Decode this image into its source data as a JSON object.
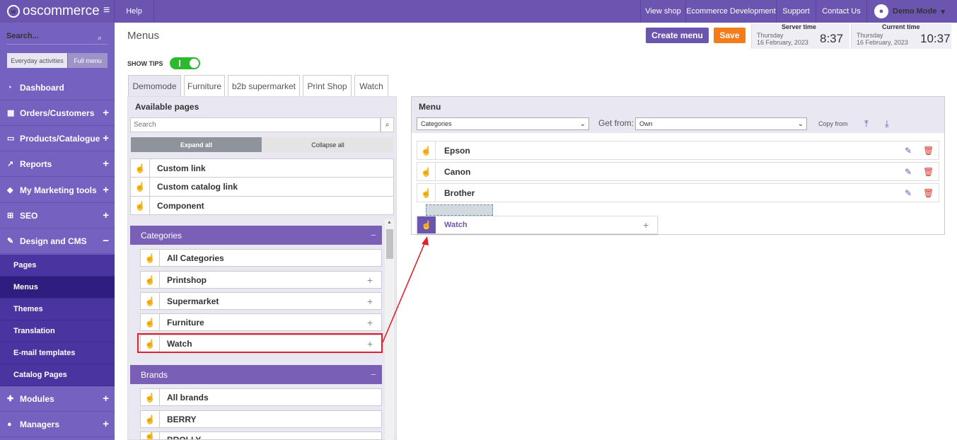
{
  "topbar": {
    "logo": "oscommerce",
    "help": "Help",
    "nav": [
      "View shop",
      "Ecommerce Development",
      "Support",
      "Contact Us"
    ],
    "user": "Demo Mode"
  },
  "sidebar": {
    "search": "Search...",
    "toggle": [
      "Everyday activities",
      "Full menu"
    ],
    "items": [
      {
        "label": "Dashboard",
        "icon": "dashboard-icon"
      },
      {
        "label": "Orders/Customers",
        "icon": "orders-icon"
      },
      {
        "label": "Products/Catalogue",
        "icon": "folder-icon"
      },
      {
        "label": "Reports",
        "icon": "chart-icon"
      },
      {
        "label": "My Marketing tools",
        "icon": "tag-icon"
      },
      {
        "label": "SEO",
        "icon": "sitemap-icon"
      },
      {
        "label": "Design and CMS",
        "icon": "brush-icon"
      }
    ],
    "subitems": [
      "Pages",
      "Menus",
      "Themes",
      "Translation",
      "E-mail templates",
      "Catalog Pages"
    ],
    "bottom": [
      {
        "label": "Modules",
        "icon": "puzzle-icon"
      },
      {
        "label": "Managers",
        "icon": "user-icon"
      }
    ]
  },
  "header": {
    "title": "Menus",
    "create": "Create menu",
    "save": "Save",
    "server": {
      "label": "Server time",
      "day": "Thursday",
      "date": "16 February, 2023",
      "time": "8:37"
    },
    "current": {
      "label": "Current time",
      "day": "Thursday",
      "date": "16 February, 2023",
      "time": "10:37"
    }
  },
  "tips": {
    "label": "SHOW TIPS"
  },
  "tabs": [
    "Demomode",
    "Furniture",
    "b2b supermarket",
    "Print Shop",
    "Watch"
  ],
  "left": {
    "title": "Available pages",
    "search_placeholder": "Search",
    "expand": "Expand all",
    "collapse": "Collapse all",
    "links": [
      "Custom link",
      "Custom catalog link",
      "Component"
    ],
    "categories_title": "Categories",
    "categories": [
      "All Categories",
      "Printshop",
      "Supermarket",
      "Furniture",
      "Watch"
    ],
    "brands_title": "Brands",
    "brands": [
      "All brands",
      "BERRY",
      "BROLLY"
    ]
  },
  "right": {
    "title": "Menu",
    "select": "Categories",
    "getfrom_label": "Get from:",
    "getfrom": "Own",
    "copyfrom": "Copy from",
    "items": [
      "Epson",
      "Canon",
      "Brother"
    ],
    "dragging": "Watch"
  },
  "colors": {
    "primary": "#6b55b0",
    "save": "#f47c1a",
    "highlight": "#e2202a"
  }
}
